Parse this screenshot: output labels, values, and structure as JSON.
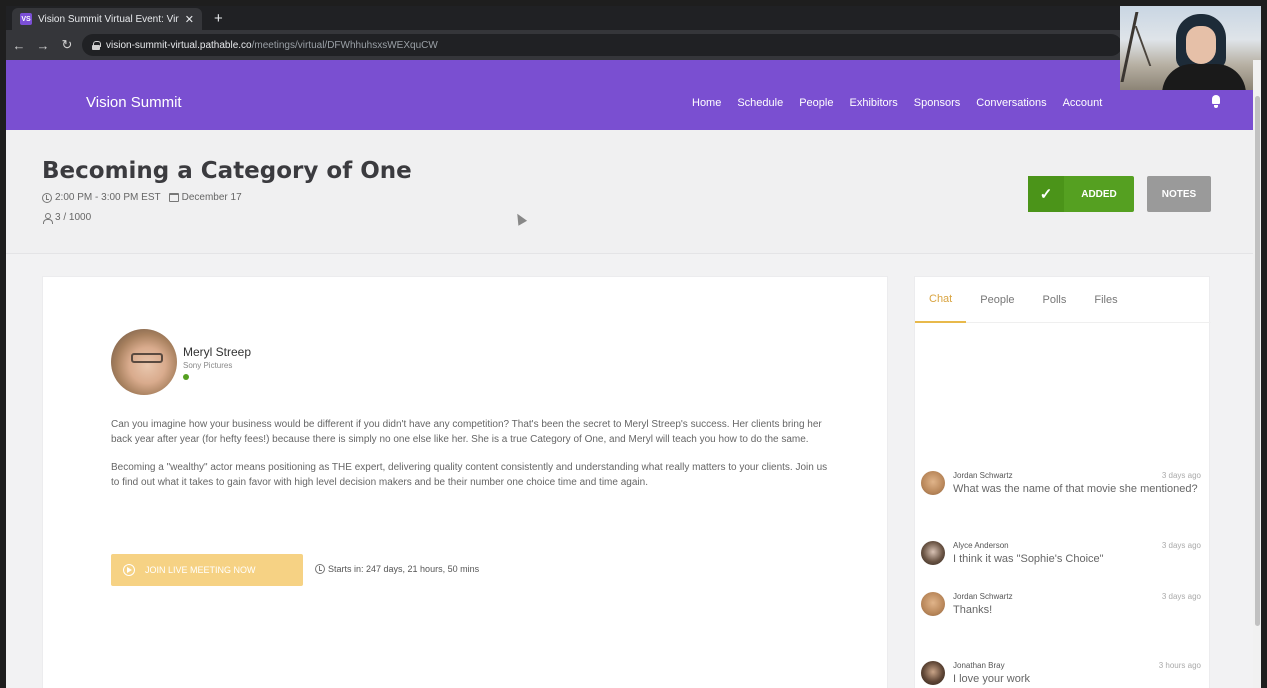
{
  "browser": {
    "tab_title": "Vision Summit Virtual Event: Virt",
    "favicon_text": "VS",
    "url_host": "vision-summit-virtual.pathable.co",
    "url_path": "/meetings/virtual/DFWhhuhsxsWEXquCW"
  },
  "site": {
    "brand": "Vision Summit",
    "nav": [
      "Home",
      "Schedule",
      "People",
      "Exhibitors",
      "Sponsors",
      "Conversations",
      "Account"
    ],
    "accent_color": "#7a4fd1"
  },
  "event": {
    "title": "Becoming a Category of One",
    "time": "2:00 PM - 3:00 PM EST",
    "date": "December 17",
    "capacity": "3 / 1000",
    "added_label": "ADDED",
    "notes_label": "NOTES"
  },
  "speaker": {
    "name": "Meryl Streep",
    "org": "Sony Pictures"
  },
  "description": {
    "p1": "Can you imagine how your business would be different if you didn't have any competition? That's been the secret to Meryl Streep's success. Her clients bring her back year after year (for hefty fees!) because there is simply no one else like her.  She is a true Category of One, and Meryl will teach you how to do the same.",
    "p2": "Becoming a \"wealthy\" actor means positioning as THE expert, delivering quality content consistently and understanding what really matters to your clients.  Join us to find out what it takes to gain favor with high level decision makers and be their number one choice time and time again."
  },
  "join": {
    "label": "JOIN LIVE MEETING NOW",
    "starts": "Starts in: 247 days, 21 hours, 50 mins"
  },
  "side": {
    "tabs": [
      "Chat",
      "People",
      "Polls",
      "Files"
    ],
    "messages": [
      {
        "name": "Jordan Schwartz",
        "time": "3 days ago",
        "text": "What was the name of that movie she mentioned?"
      },
      {
        "name": "Alyce Anderson",
        "time": "3 days ago",
        "text": "I think it was \"Sophie's Choice\""
      },
      {
        "name": "Jordan Schwartz",
        "time": "3 days ago",
        "text": "Thanks!"
      },
      {
        "name": "Jonathan Bray",
        "time": "3 hours ago",
        "text": "I love your work"
      }
    ]
  }
}
